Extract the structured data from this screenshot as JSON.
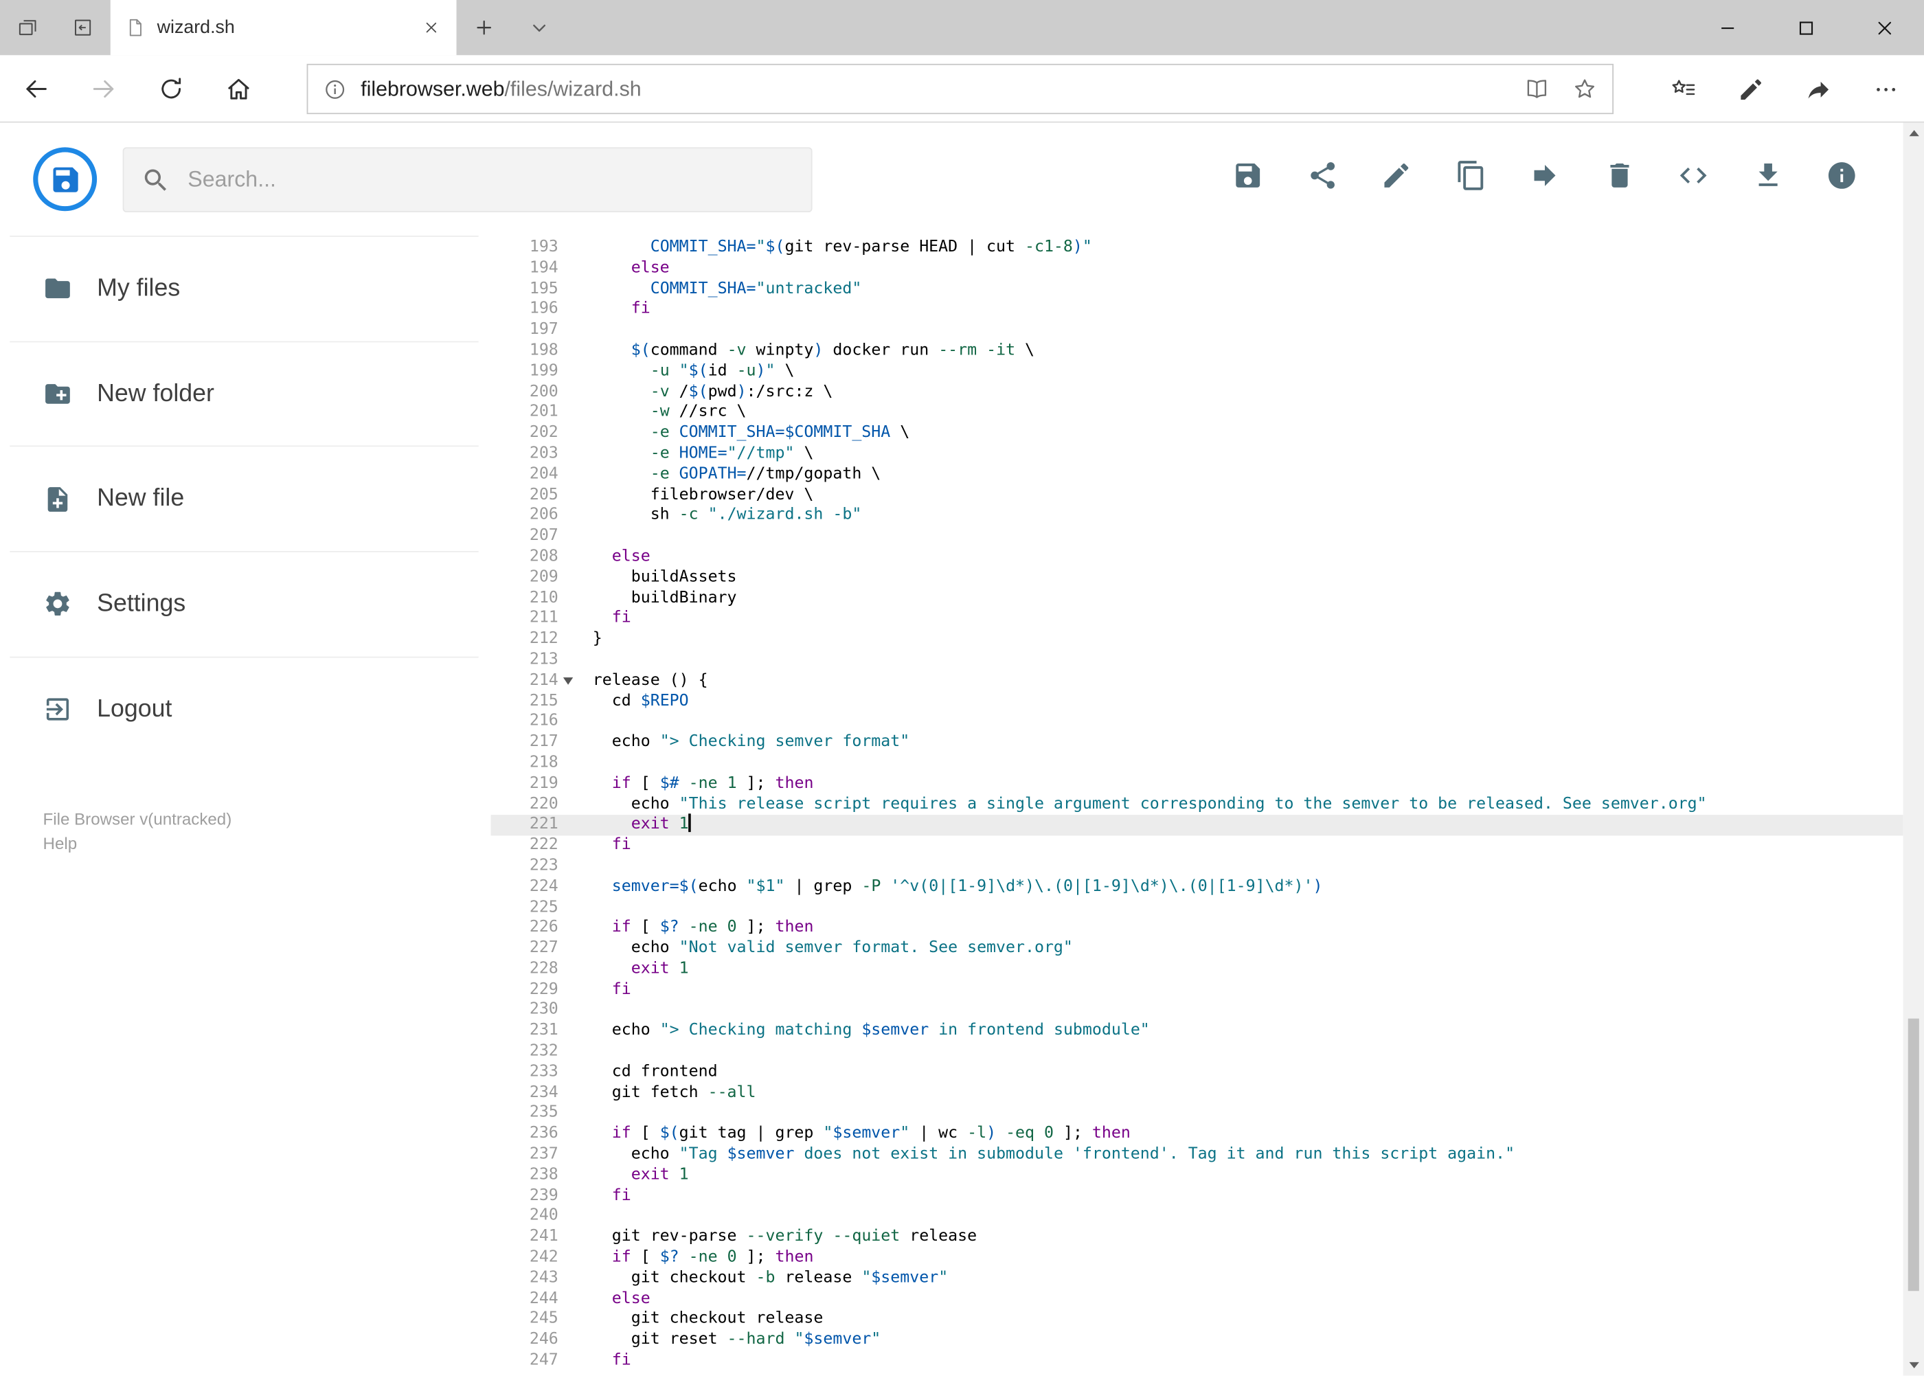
{
  "browser": {
    "tab_title": "wizard.sh",
    "url_host": "filebrowser.web",
    "url_path": "/files/wizard.sh"
  },
  "app": {
    "search_placeholder": "Search...",
    "sidebar": {
      "items": [
        {
          "label": "My files",
          "icon": "folder"
        },
        {
          "label": "New folder",
          "icon": "new-folder"
        },
        {
          "label": "New file",
          "icon": "new-file"
        },
        {
          "label": "Settings",
          "icon": "settings"
        },
        {
          "label": "Logout",
          "icon": "logout"
        }
      ],
      "footer_version": "File Browser v(untracked)",
      "footer_help": "Help"
    },
    "toolbar": [
      {
        "name": "save",
        "icon": "save"
      },
      {
        "name": "share",
        "icon": "share"
      },
      {
        "name": "edit",
        "icon": "edit"
      },
      {
        "name": "copy",
        "icon": "copy"
      },
      {
        "name": "move",
        "icon": "move"
      },
      {
        "name": "delete",
        "icon": "delete"
      },
      {
        "name": "view-code",
        "icon": "code"
      },
      {
        "name": "download",
        "icon": "download"
      },
      {
        "name": "info",
        "icon": "info"
      }
    ]
  },
  "editor": {
    "active_line": 221,
    "cursor_line": 221,
    "fold_marker_line": 214,
    "colors": {
      "plain": "#000000",
      "keyword": "#770088",
      "string": "#0b7285",
      "variable": "#0055aa",
      "number": "#116644",
      "line_number": "#999999",
      "active_line_bg": "#ececec"
    },
    "lines": [
      {
        "n": 193,
        "t": [
          [
            "p",
            "      "
          ],
          [
            "v",
            "COMMIT_SHA="
          ],
          [
            "s",
            "\""
          ],
          [
            "v",
            "$("
          ],
          [
            "p",
            "git rev-parse HEAD | cut "
          ],
          [
            "n",
            "-c1-8"
          ],
          [
            "v",
            ")"
          ],
          [
            "s",
            "\""
          ]
        ]
      },
      {
        "n": 194,
        "t": [
          [
            "p",
            "    "
          ],
          [
            "k",
            "else"
          ]
        ]
      },
      {
        "n": 195,
        "t": [
          [
            "p",
            "      "
          ],
          [
            "v",
            "COMMIT_SHA="
          ],
          [
            "s",
            "\"untracked\""
          ]
        ]
      },
      {
        "n": 196,
        "t": [
          [
            "p",
            "    "
          ],
          [
            "k",
            "fi"
          ]
        ]
      },
      {
        "n": 197,
        "t": []
      },
      {
        "n": 198,
        "t": [
          [
            "p",
            "    "
          ],
          [
            "v",
            "$("
          ],
          [
            "p",
            "command "
          ],
          [
            "n",
            "-v"
          ],
          [
            "p",
            " winpty"
          ],
          [
            "v",
            ")"
          ],
          [
            "p",
            " docker run "
          ],
          [
            "n",
            "--rm"
          ],
          [
            "p",
            " "
          ],
          [
            "n",
            "-it"
          ],
          [
            "p",
            " \\"
          ]
        ]
      },
      {
        "n": 199,
        "t": [
          [
            "p",
            "      "
          ],
          [
            "n",
            "-u"
          ],
          [
            "p",
            " "
          ],
          [
            "s",
            "\""
          ],
          [
            "v",
            "$("
          ],
          [
            "p",
            "id "
          ],
          [
            "n",
            "-u"
          ],
          [
            "v",
            ")"
          ],
          [
            "s",
            "\""
          ],
          [
            "p",
            " \\"
          ]
        ]
      },
      {
        "n": 200,
        "t": [
          [
            "p",
            "      "
          ],
          [
            "n",
            "-v"
          ],
          [
            "p",
            " /"
          ],
          [
            "v",
            "$("
          ],
          [
            "p",
            "pwd"
          ],
          [
            "v",
            ")"
          ],
          [
            "p",
            ":/src:z \\"
          ]
        ]
      },
      {
        "n": 201,
        "t": [
          [
            "p",
            "      "
          ],
          [
            "n",
            "-w"
          ],
          [
            "p",
            " //src \\"
          ]
        ]
      },
      {
        "n": 202,
        "t": [
          [
            "p",
            "      "
          ],
          [
            "n",
            "-e"
          ],
          [
            "p",
            " "
          ],
          [
            "v",
            "COMMIT_SHA=$COMMIT_SHA"
          ],
          [
            "p",
            " \\"
          ]
        ]
      },
      {
        "n": 203,
        "t": [
          [
            "p",
            "      "
          ],
          [
            "n",
            "-e"
          ],
          [
            "p",
            " "
          ],
          [
            "v",
            "HOME="
          ],
          [
            "s",
            "\"//tmp\""
          ],
          [
            "p",
            " \\"
          ]
        ]
      },
      {
        "n": 204,
        "t": [
          [
            "p",
            "      "
          ],
          [
            "n",
            "-e"
          ],
          [
            "p",
            " "
          ],
          [
            "v",
            "GOPATH="
          ],
          [
            "p",
            "//tmp/gopath \\"
          ]
        ]
      },
      {
        "n": 205,
        "t": [
          [
            "p",
            "      filebrowser/dev \\"
          ]
        ]
      },
      {
        "n": 206,
        "t": [
          [
            "p",
            "      sh "
          ],
          [
            "n",
            "-c"
          ],
          [
            "p",
            " "
          ],
          [
            "s",
            "\"./wizard.sh -b\""
          ]
        ]
      },
      {
        "n": 207,
        "t": []
      },
      {
        "n": 208,
        "t": [
          [
            "p",
            "  "
          ],
          [
            "k",
            "else"
          ]
        ]
      },
      {
        "n": 209,
        "t": [
          [
            "p",
            "    buildAssets"
          ]
        ]
      },
      {
        "n": 210,
        "t": [
          [
            "p",
            "    buildBinary"
          ]
        ]
      },
      {
        "n": 211,
        "t": [
          [
            "p",
            "  "
          ],
          [
            "k",
            "fi"
          ]
        ]
      },
      {
        "n": 212,
        "t": [
          [
            "p",
            "}"
          ]
        ]
      },
      {
        "n": 213,
        "t": []
      },
      {
        "n": 214,
        "t": [
          [
            "p",
            "release () {"
          ]
        ]
      },
      {
        "n": 215,
        "t": [
          [
            "p",
            "  cd "
          ],
          [
            "v",
            "$REPO"
          ]
        ]
      },
      {
        "n": 216,
        "t": []
      },
      {
        "n": 217,
        "t": [
          [
            "p",
            "  echo "
          ],
          [
            "s",
            "\"> Checking semver format\""
          ]
        ]
      },
      {
        "n": 218,
        "t": []
      },
      {
        "n": 219,
        "t": [
          [
            "p",
            "  "
          ],
          [
            "k",
            "if"
          ],
          [
            "p",
            " [ "
          ],
          [
            "v",
            "$#"
          ],
          [
            "p",
            " "
          ],
          [
            "n",
            "-ne"
          ],
          [
            "p",
            " "
          ],
          [
            "n",
            "1"
          ],
          [
            "p",
            " ]; "
          ],
          [
            "k",
            "then"
          ]
        ]
      },
      {
        "n": 220,
        "t": [
          [
            "p",
            "    echo "
          ],
          [
            "s",
            "\"This release script requires a single argument corresponding to the semver to be released. See semver.org\""
          ]
        ]
      },
      {
        "n": 221,
        "t": [
          [
            "p",
            "    "
          ],
          [
            "k",
            "exit"
          ],
          [
            "p",
            " "
          ],
          [
            "n",
            "1"
          ]
        ]
      },
      {
        "n": 222,
        "t": [
          [
            "p",
            "  "
          ],
          [
            "k",
            "fi"
          ]
        ]
      },
      {
        "n": 223,
        "t": []
      },
      {
        "n": 224,
        "t": [
          [
            "p",
            "  "
          ],
          [
            "v",
            "semver=$("
          ],
          [
            "p",
            "echo "
          ],
          [
            "s",
            "\"$1\""
          ],
          [
            "p",
            " | grep "
          ],
          [
            "n",
            "-P"
          ],
          [
            "p",
            " "
          ],
          [
            "s",
            "'^v(0|[1-9]\\d*)\\.(0|[1-9]\\d*)\\.(0|[1-9]\\d*)'"
          ],
          [
            "v",
            ")"
          ]
        ]
      },
      {
        "n": 225,
        "t": []
      },
      {
        "n": 226,
        "t": [
          [
            "p",
            "  "
          ],
          [
            "k",
            "if"
          ],
          [
            "p",
            " [ "
          ],
          [
            "v",
            "$?"
          ],
          [
            "p",
            " "
          ],
          [
            "n",
            "-ne"
          ],
          [
            "p",
            " "
          ],
          [
            "n",
            "0"
          ],
          [
            "p",
            " ]; "
          ],
          [
            "k",
            "then"
          ]
        ]
      },
      {
        "n": 227,
        "t": [
          [
            "p",
            "    echo "
          ],
          [
            "s",
            "\"Not valid semver format. See semver.org\""
          ]
        ]
      },
      {
        "n": 228,
        "t": [
          [
            "p",
            "    "
          ],
          [
            "k",
            "exit"
          ],
          [
            "p",
            " "
          ],
          [
            "n",
            "1"
          ]
        ]
      },
      {
        "n": 229,
        "t": [
          [
            "p",
            "  "
          ],
          [
            "k",
            "fi"
          ]
        ]
      },
      {
        "n": 230,
        "t": []
      },
      {
        "n": 231,
        "t": [
          [
            "p",
            "  echo "
          ],
          [
            "s",
            "\"> Checking matching "
          ],
          [
            "v",
            "$semver"
          ],
          [
            "s",
            " in frontend submodule\""
          ]
        ]
      },
      {
        "n": 232,
        "t": []
      },
      {
        "n": 233,
        "t": [
          [
            "p",
            "  cd frontend"
          ]
        ]
      },
      {
        "n": 234,
        "t": [
          [
            "p",
            "  git fetch "
          ],
          [
            "n",
            "--all"
          ]
        ]
      },
      {
        "n": 235,
        "t": []
      },
      {
        "n": 236,
        "t": [
          [
            "p",
            "  "
          ],
          [
            "k",
            "if"
          ],
          [
            "p",
            " [ "
          ],
          [
            "v",
            "$("
          ],
          [
            "p",
            "git tag | grep "
          ],
          [
            "s",
            "\""
          ],
          [
            "v",
            "$semver"
          ],
          [
            "s",
            "\""
          ],
          [
            "p",
            " | wc "
          ],
          [
            "n",
            "-l"
          ],
          [
            "v",
            ")"
          ],
          [
            "p",
            " "
          ],
          [
            "n",
            "-eq"
          ],
          [
            "p",
            " "
          ],
          [
            "n",
            "0"
          ],
          [
            "p",
            " ]; "
          ],
          [
            "k",
            "then"
          ]
        ]
      },
      {
        "n": 237,
        "t": [
          [
            "p",
            "    echo "
          ],
          [
            "s",
            "\"Tag "
          ],
          [
            "v",
            "$semver"
          ],
          [
            "s",
            " does not exist in submodule 'frontend'. Tag it and run this script again.\""
          ]
        ]
      },
      {
        "n": 238,
        "t": [
          [
            "p",
            "    "
          ],
          [
            "k",
            "exit"
          ],
          [
            "p",
            " "
          ],
          [
            "n",
            "1"
          ]
        ]
      },
      {
        "n": 239,
        "t": [
          [
            "p",
            "  "
          ],
          [
            "k",
            "fi"
          ]
        ]
      },
      {
        "n": 240,
        "t": []
      },
      {
        "n": 241,
        "t": [
          [
            "p",
            "  git rev-parse "
          ],
          [
            "n",
            "--verify"
          ],
          [
            "p",
            " "
          ],
          [
            "n",
            "--quiet"
          ],
          [
            "p",
            " release"
          ]
        ]
      },
      {
        "n": 242,
        "t": [
          [
            "p",
            "  "
          ],
          [
            "k",
            "if"
          ],
          [
            "p",
            " [ "
          ],
          [
            "v",
            "$?"
          ],
          [
            "p",
            " "
          ],
          [
            "n",
            "-ne"
          ],
          [
            "p",
            " "
          ],
          [
            "n",
            "0"
          ],
          [
            "p",
            " ]; "
          ],
          [
            "k",
            "then"
          ]
        ]
      },
      {
        "n": 243,
        "t": [
          [
            "p",
            "    git checkout "
          ],
          [
            "n",
            "-b"
          ],
          [
            "p",
            " release "
          ],
          [
            "s",
            "\""
          ],
          [
            "v",
            "$semver"
          ],
          [
            "s",
            "\""
          ]
        ]
      },
      {
        "n": 244,
        "t": [
          [
            "p",
            "  "
          ],
          [
            "k",
            "else"
          ]
        ]
      },
      {
        "n": 245,
        "t": [
          [
            "p",
            "    git checkout release"
          ]
        ]
      },
      {
        "n": 246,
        "t": [
          [
            "p",
            "    git reset "
          ],
          [
            "n",
            "--hard"
          ],
          [
            "p",
            " "
          ],
          [
            "s",
            "\""
          ],
          [
            "v",
            "$semver"
          ],
          [
            "s",
            "\""
          ]
        ]
      },
      {
        "n": 247,
        "t": [
          [
            "p",
            "  "
          ],
          [
            "k",
            "fi"
          ]
        ]
      }
    ]
  }
}
